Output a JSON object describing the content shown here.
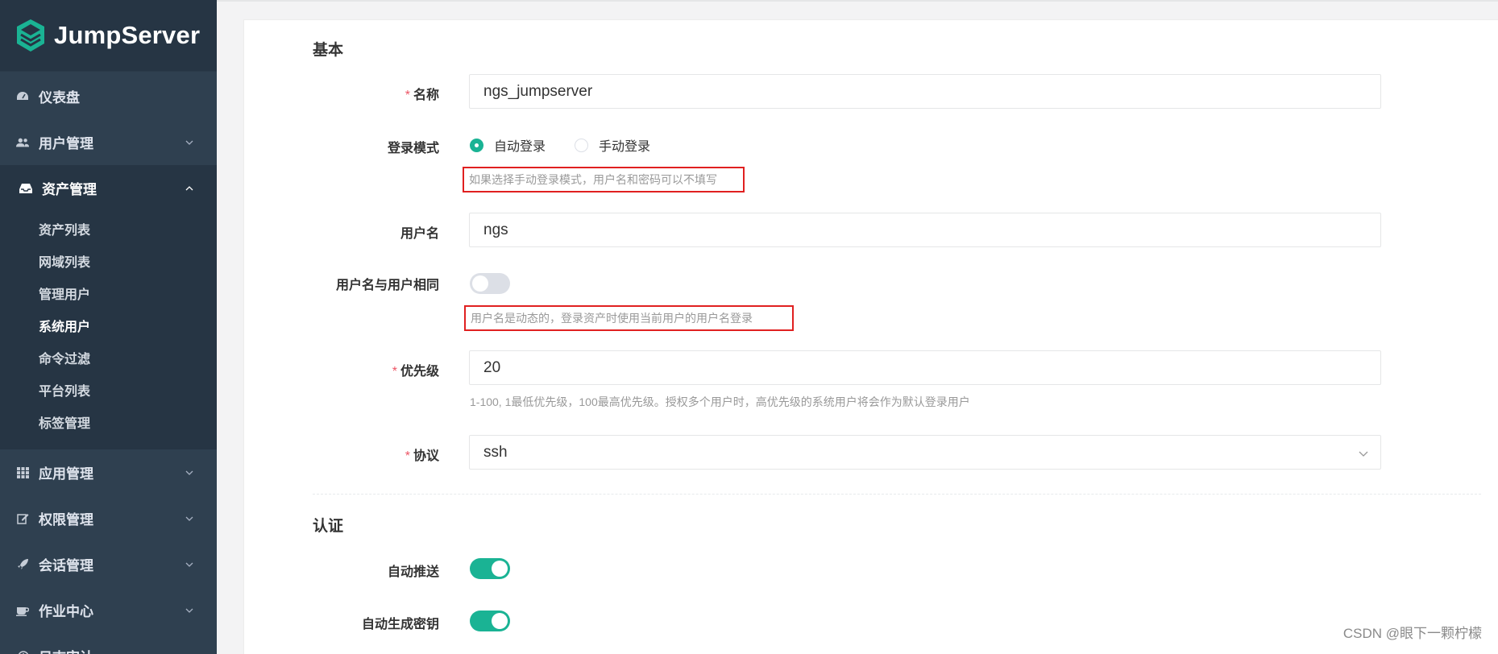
{
  "brand": {
    "name": "JumpServer"
  },
  "sidebar": {
    "items": [
      {
        "label": "仪表盘",
        "icon": "dashboard-icon",
        "has_children": false
      },
      {
        "label": "用户管理",
        "icon": "users-icon",
        "has_children": true
      },
      {
        "label": "资产管理",
        "icon": "inbox-icon",
        "has_children": true,
        "open": true,
        "children": [
          "资产列表",
          "网域列表",
          "管理用户",
          "系统用户",
          "命令过滤",
          "平台列表",
          "标签管理"
        ],
        "active_child": "系统用户"
      },
      {
        "label": "应用管理",
        "icon": "grid-icon",
        "has_children": true
      },
      {
        "label": "权限管理",
        "icon": "edit-icon",
        "has_children": true
      },
      {
        "label": "会话管理",
        "icon": "rocket-icon",
        "has_children": true
      },
      {
        "label": "作业中心",
        "icon": "coffee-icon",
        "has_children": true
      },
      {
        "label": "日志审计",
        "icon": "history-icon",
        "has_children": true
      }
    ]
  },
  "form": {
    "section_basic": "基本",
    "name": {
      "label": "名称",
      "value": "ngs_jumpserver",
      "required": true
    },
    "login_mode": {
      "label": "登录模式",
      "options": [
        "自动登录",
        "手动登录"
      ],
      "selected": "自动登录",
      "hint": "如果选择手动登录模式，用户名和密码可以不填写"
    },
    "username": {
      "label": "用户名",
      "value": "ngs"
    },
    "username_same": {
      "label": "用户名与用户相同",
      "on": false,
      "hint": "用户名是动态的，登录资产时使用当前用户的用户名登录"
    },
    "priority": {
      "label": "优先级",
      "value": "20",
      "required": true,
      "help": "1-100, 1最低优先级，100最高优先级。授权多个用户时，高优先级的系统用户将会作为默认登录用户"
    },
    "protocol": {
      "label": "协议",
      "value": "ssh",
      "required": true
    },
    "section_auth": "认证",
    "auto_push": {
      "label": "自动推送",
      "on": true
    },
    "auto_generate_key": {
      "label": "自动生成密钥",
      "on": true
    }
  },
  "watermark": "CSDN @眼下一颗柠檬",
  "colors": {
    "sidebar_bg": "#2f4050",
    "sidebar_dark": "#263544",
    "accent": "#1ab394",
    "required": "#ed5565",
    "highlight_border": "#e02020"
  }
}
